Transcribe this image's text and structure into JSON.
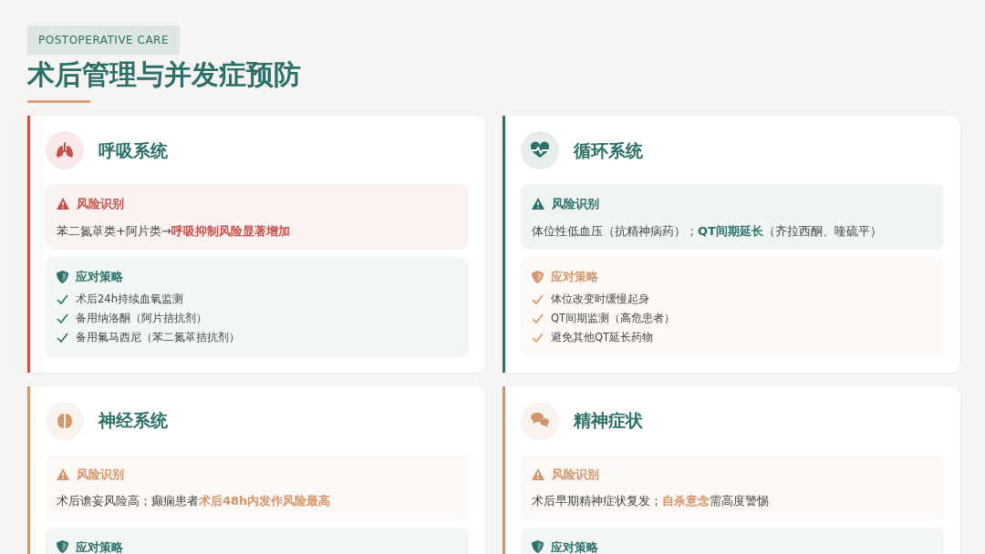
{
  "header": {
    "tag": "POSTOPERATIVE CARE",
    "title": "术后管理与并发症预防"
  },
  "cards": [
    {
      "kind": "lungs",
      "title": "呼吸系统",
      "color": "#c9504a",
      "risk": {
        "heading": "风险识别",
        "color": "#c9504a",
        "text": "苯二氮䓬类+阿片类→**呼吸抑制风险显著增加**"
      },
      "strategy": {
        "heading": "应对策略",
        "color": "#2a6f68",
        "items": [
          "术后24h持续血氧监测",
          "备用纳洛酮（阿片拮抗剂）",
          "备用氟马西尼（苯二氮䓬拮抗剂）"
        ]
      }
    },
    {
      "kind": "heart",
      "title": "循环系统",
      "color": "#2a6f68",
      "risk": {
        "heading": "风险识别",
        "color": "#2a6f68",
        "text": "体位性低血压（抗精神病药）；**QT间期延长**（齐拉西酮、喹硫平）"
      },
      "strategy": {
        "heading": "应对策略",
        "color": "#d4956a",
        "items": [
          "体位改变时缓慢起身",
          "QT间期监测（高危患者）",
          "避免其他QT延长药物"
        ]
      }
    },
    {
      "kind": "brain",
      "title": "神经系统",
      "color": "#d4956a",
      "risk": {
        "heading": "风险识别",
        "color": "#d4956a",
        "text": "术后谵妄风险高；癫痫患者**术后48h内发作风险最高**"
      },
      "strategy": {
        "heading": "应对策略",
        "color": "#2a6f68"
      }
    },
    {
      "kind": "chat",
      "title": "精神症状",
      "color": "#d4956a",
      "risk": {
        "heading": "风险识别",
        "color": "#d4956a",
        "text": "术后早期精神症状复发；**自杀意念**需高度警惕"
      },
      "strategy": {
        "heading": "应对策略",
        "color": "#2a6f68"
      }
    }
  ]
}
